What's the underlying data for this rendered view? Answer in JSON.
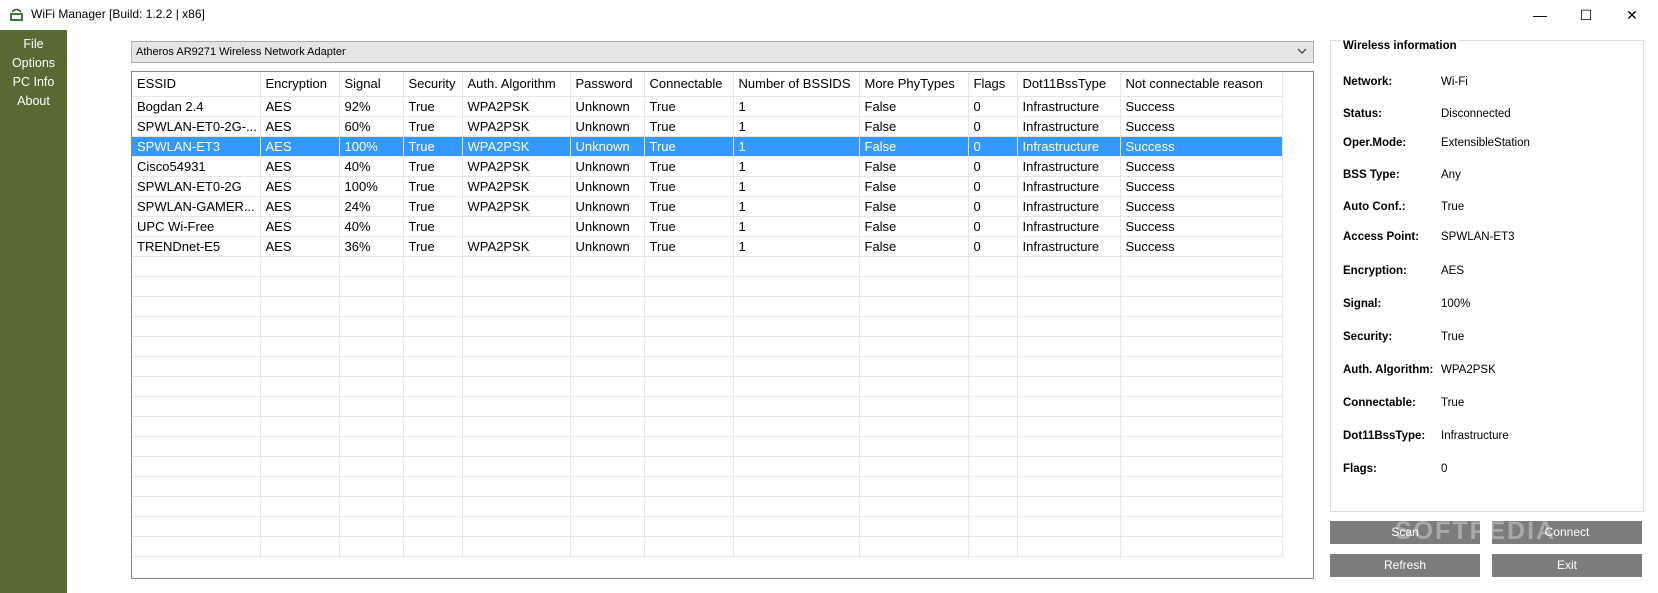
{
  "window": {
    "title": "WiFi Manager [Build: 1.2.2 | x86]"
  },
  "sidebar": {
    "items": [
      {
        "label": "File"
      },
      {
        "label": "Options"
      },
      {
        "label": "PC Info"
      },
      {
        "label": "About"
      }
    ]
  },
  "adapter": {
    "selected": "Atheros AR9271 Wireless Network Adapter"
  },
  "table": {
    "columns": [
      "ESSID",
      "Encryption",
      "Signal",
      "Security",
      "Auth. Algorithm",
      "Password",
      "Connectable",
      "Number of BSSIDS",
      "More PhyTypes",
      "Flags",
      "Dot11BssType",
      "Not connectable reason"
    ],
    "rows": [
      [
        "Bogdan 2.4",
        "AES",
        "92%",
        "True",
        "WPA2PSK",
        "Unknown",
        "True",
        "1",
        "False",
        "0",
        "Infrastructure",
        "Success"
      ],
      [
        "SPWLAN-ET0-2G-...",
        "AES",
        "60%",
        "True",
        "WPA2PSK",
        "Unknown",
        "True",
        "1",
        "False",
        "0",
        "Infrastructure",
        "Success"
      ],
      [
        "SPWLAN-ET3",
        "AES",
        "100%",
        "True",
        "WPA2PSK",
        "Unknown",
        "True",
        "1",
        "False",
        "0",
        "Infrastructure",
        "Success"
      ],
      [
        "Cisco54931",
        "AES",
        "40%",
        "True",
        "WPA2PSK",
        "Unknown",
        "True",
        "1",
        "False",
        "0",
        "Infrastructure",
        "Success"
      ],
      [
        "SPWLAN-ET0-2G",
        "AES",
        "100%",
        "True",
        "WPA2PSK",
        "Unknown",
        "True",
        "1",
        "False",
        "0",
        "Infrastructure",
        "Success"
      ],
      [
        "SPWLAN-GAMER...",
        "AES",
        "24%",
        "True",
        "WPA2PSK",
        "Unknown",
        "True",
        "1",
        "False",
        "0",
        "Infrastructure",
        "Success"
      ],
      [
        "UPC Wi-Free",
        "AES",
        "40%",
        "True",
        "",
        "Unknown",
        "True",
        "1",
        "False",
        "0",
        "Infrastructure",
        "Success"
      ],
      [
        "TRENDnet-E5",
        "AES",
        "36%",
        "True",
        "WPA2PSK",
        "Unknown",
        "True",
        "1",
        "False",
        "0",
        "Infrastructure",
        "Success"
      ]
    ],
    "selected_row": 2
  },
  "info": {
    "title": "Wireless information",
    "fields": [
      {
        "label": "Network:",
        "value": "Wi-Fi"
      },
      {
        "label": "Status:",
        "value": "Disconnected"
      },
      {
        "label": "Oper.Mode:",
        "value": "ExtensibleStation"
      },
      {
        "label": "BSS Type:",
        "value": "Any"
      },
      {
        "label": "Auto Conf.:",
        "value": "True"
      },
      {
        "label": "Access Point:",
        "value": "SPWLAN-ET3"
      },
      {
        "label": "Encryption:",
        "value": "AES"
      },
      {
        "label": "Signal:",
        "value": "100%"
      },
      {
        "label": "Security:",
        "value": "True"
      },
      {
        "label": "Auth. Algorithm:",
        "value": "WPA2PSK"
      },
      {
        "label": "Connectable:",
        "value": "True"
      },
      {
        "label": "Dot11BssType:",
        "value": "Infrastructure"
      },
      {
        "label": "Flags:",
        "value": "0"
      }
    ]
  },
  "buttons": {
    "scan": "Scan",
    "connect": "Connect",
    "refresh": "Refresh",
    "exit": "Exit"
  },
  "watermark": "SOFTPEDIA",
  "colors": {
    "sidebar": "#586a34",
    "selection": "#3399ff",
    "button": "#7c7c7c"
  }
}
